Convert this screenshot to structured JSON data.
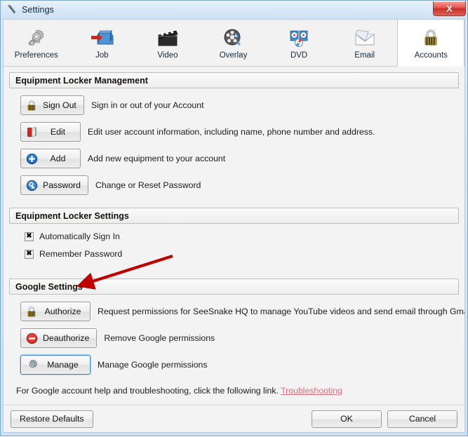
{
  "window": {
    "title": "Settings",
    "title_icon": "wrench-icon",
    "close_label": "X"
  },
  "toolbar": {
    "tabs": [
      {
        "label": "Preferences",
        "icon": "gear-icon",
        "selected": false
      },
      {
        "label": "Job",
        "icon": "job-box-arrow-icon",
        "selected": false
      },
      {
        "label": "Video",
        "icon": "clapperboard-icon",
        "selected": false
      },
      {
        "label": "Overlay",
        "icon": "film-reel-icon",
        "selected": false
      },
      {
        "label": "DVD",
        "icon": "dvd-disc-icon",
        "selected": false
      },
      {
        "label": "Email",
        "icon": "envelope-icon",
        "selected": false
      },
      {
        "label": "Accounts",
        "icon": "padlock-icon",
        "selected": true
      }
    ]
  },
  "sections": {
    "equipment_management": {
      "header": "Equipment Locker Management",
      "rows": [
        {
          "button": "Sign Out",
          "icon": "padlock-icon",
          "desc": "Sign in or out of your Account",
          "focused": false
        },
        {
          "button": "Edit",
          "icon": "red-book-icon",
          "desc": "Edit user account information, including name, phone number and address.",
          "focused": false
        },
        {
          "button": "Add",
          "icon": "blue-plus-icon",
          "desc": "Add new equipment to your account",
          "focused": false
        },
        {
          "button": "Password",
          "icon": "blue-key-icon",
          "desc": "Change or Reset Password",
          "focused": false
        }
      ]
    },
    "equipment_settings": {
      "header": "Equipment Locker Settings",
      "checkboxes": [
        {
          "label": "Automatically Sign In",
          "checked": true,
          "mark": "✖"
        },
        {
          "label": "Remember Password",
          "checked": true,
          "mark": "✖"
        }
      ]
    },
    "google_settings": {
      "header": "Google Settings",
      "rows": [
        {
          "button": "Authorize",
          "icon": "padlock-icon",
          "desc": "Request permissions for SeeSnake HQ to manage YouTube videos and send email through Gmail",
          "focused": false
        },
        {
          "button": "Deauthorize",
          "icon": "red-deny-icon",
          "desc": "Remove Google permissions",
          "focused": false
        },
        {
          "button": "Manage",
          "icon": "gear-icon",
          "desc": "Manage Google permissions",
          "focused": true
        }
      ],
      "footnote_text": "For Google account help and troubleshooting, click the following link.",
      "footnote_link": "Troubleshooting"
    }
  },
  "bottom_bar": {
    "restore_defaults": "Restore Defaults",
    "ok": "OK",
    "cancel": "Cancel"
  },
  "annotation": {
    "type": "arrow",
    "color": "#c00000",
    "points_to": "Google Settings"
  },
  "colors": {
    "accent": "#c00000",
    "link": "#e06c7d",
    "titlebar": "#d7e7f7",
    "close_button": "#c8302a"
  }
}
